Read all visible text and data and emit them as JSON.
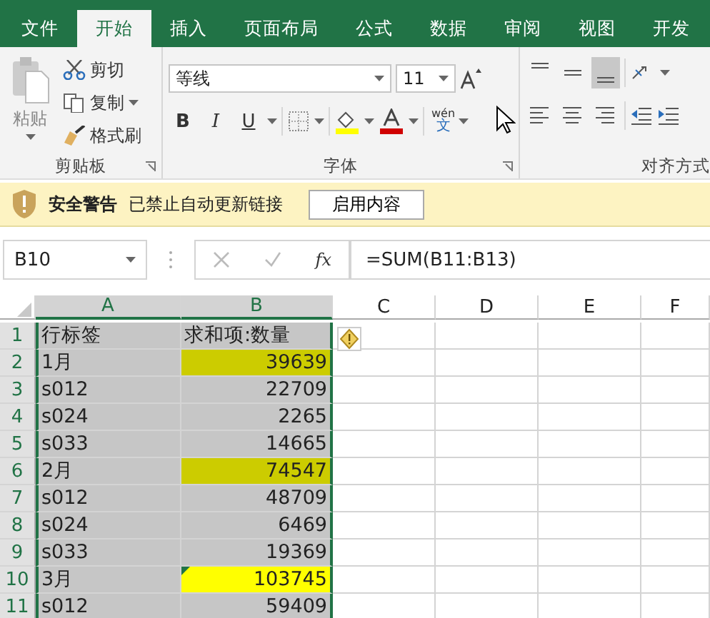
{
  "tabs": [
    {
      "label": "文件",
      "selected": false
    },
    {
      "label": "开始",
      "selected": true
    },
    {
      "label": "插入",
      "selected": false
    },
    {
      "label": "页面布局",
      "selected": false
    },
    {
      "label": "公式",
      "selected": false
    },
    {
      "label": "数据",
      "selected": false
    },
    {
      "label": "审阅",
      "selected": false
    },
    {
      "label": "视图",
      "selected": false
    },
    {
      "label": "开发",
      "selected": false
    }
  ],
  "ribbon": {
    "clipboard": {
      "paste": "粘贴",
      "cut": "剪切",
      "copy": "复制",
      "format_painter": "格式刷",
      "label": "剪贴板"
    },
    "font": {
      "font_name": "等线",
      "font_size": "11",
      "bold": "B",
      "italic": "I",
      "underline": "U",
      "phonetic": "wén",
      "phonetic_char": "文",
      "label": "字体"
    },
    "alignment": {
      "label": "对齐方式",
      "vertical": [
        {
          "kind": "top",
          "selected": false
        },
        {
          "kind": "middle",
          "selected": false
        },
        {
          "kind": "bottom",
          "selected": true
        }
      ],
      "horizontal": [
        {
          "kind": "left",
          "selected": false
        },
        {
          "kind": "center",
          "selected": false
        },
        {
          "kind": "right",
          "selected": false
        }
      ]
    }
  },
  "security_bar": {
    "title": "安全警告",
    "message": "已禁止自动更新链接",
    "button": "启用内容"
  },
  "formula_bar": {
    "name_box": "B10",
    "function_label": "fx",
    "formula": "=SUM(B11:B13)"
  },
  "sheet": {
    "columns": [
      {
        "label": "A",
        "selected": true
      },
      {
        "label": "B",
        "selected": true
      },
      {
        "label": "C",
        "selected": false
      },
      {
        "label": "D",
        "selected": false
      },
      {
        "label": "E",
        "selected": false
      },
      {
        "label": "F",
        "selected": false
      }
    ],
    "rows": [
      {
        "number": "1",
        "selected": true,
        "label": "行标签",
        "value": "求和项:数量",
        "kind": "header"
      },
      {
        "number": "2",
        "selected": true,
        "label": "1月",
        "value": "39639",
        "kind": "number",
        "color": "#cccc00"
      },
      {
        "number": "3",
        "selected": true,
        "label": "s012",
        "value": "22709",
        "kind": "number"
      },
      {
        "number": "4",
        "selected": true,
        "label": "s024",
        "value": "2265",
        "kind": "number"
      },
      {
        "number": "5",
        "selected": true,
        "label": "s033",
        "value": "14665",
        "kind": "number"
      },
      {
        "number": "6",
        "selected": true,
        "label": "2月",
        "value": "74547",
        "kind": "number",
        "color": "#cccc00"
      },
      {
        "number": "7",
        "selected": true,
        "label": "s012",
        "value": "48709",
        "kind": "number"
      },
      {
        "number": "8",
        "selected": true,
        "label": "s024",
        "value": "6469",
        "kind": "number"
      },
      {
        "number": "9",
        "selected": true,
        "label": "s033",
        "value": "19369",
        "kind": "number"
      },
      {
        "number": "10",
        "selected": true,
        "label": "3月",
        "value": "103745",
        "kind": "number",
        "color": "#ffff00",
        "error_indicator": true
      },
      {
        "number": "11",
        "selected": true,
        "label": "s012",
        "value": "59409",
        "kind": "number"
      }
    ]
  }
}
